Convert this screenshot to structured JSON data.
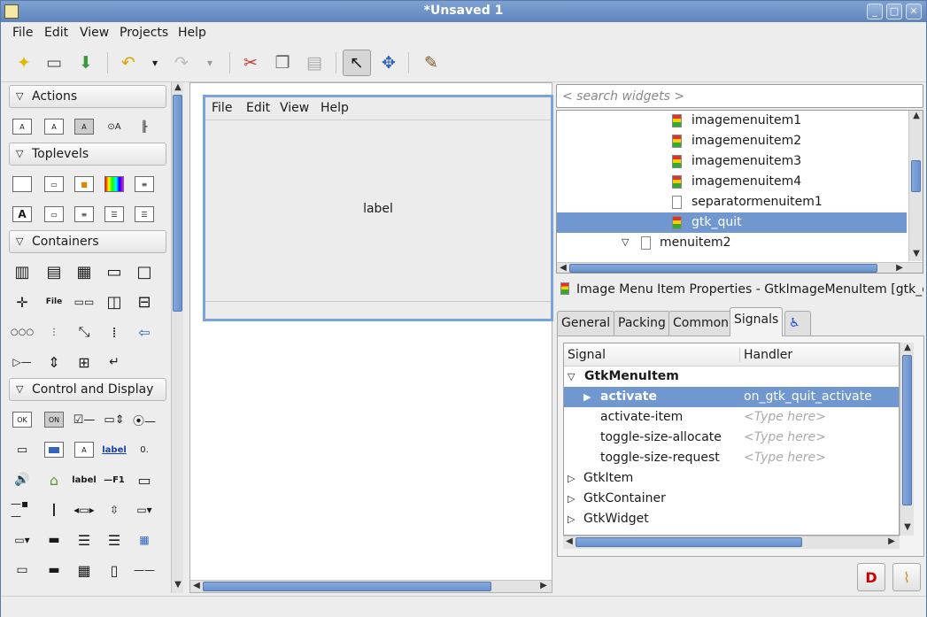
{
  "window": {
    "title": "*Unsaved 1"
  },
  "menubar": [
    "File",
    "Edit",
    "View",
    "Projects",
    "Help"
  ],
  "palette": {
    "groups": [
      "Actions",
      "Toplevels",
      "Containers",
      "Control and Display"
    ],
    "sample_texts": {
      "file": "File",
      "ok": "OK",
      "on": "ON",
      "label": "label",
      "label2": "label",
      "f1": "—F1",
      "a": "A"
    }
  },
  "design": {
    "menus": [
      "File",
      "Edit",
      "View",
      "Help"
    ],
    "label": "label"
  },
  "search": {
    "placeholder": "< search widgets >"
  },
  "tree": {
    "items": [
      "imagemenuitem1",
      "imagemenuitem2",
      "imagemenuitem3",
      "imagemenuitem4",
      "separatormenuitem1",
      "gtk_quit",
      "menuitem2"
    ],
    "selected": "gtk_quit"
  },
  "props": {
    "title": "Image Menu Item Properties - GtkImageMenuItem [gtk_q...",
    "tabs": [
      "General",
      "Packing",
      "Common",
      "Signals"
    ],
    "active_tab": "Signals"
  },
  "signals": {
    "headers": {
      "signal": "Signal",
      "handler": "Handler"
    },
    "group": "GtkMenuItem",
    "rows": [
      {
        "signal": "activate",
        "handler": "on_gtk_quit_activate"
      },
      {
        "signal": "activate-item",
        "handler": "<Type here>"
      },
      {
        "signal": "toggle-size-allocate",
        "handler": "<Type here>"
      },
      {
        "signal": "toggle-size-request",
        "handler": "<Type here>"
      }
    ],
    "other_groups": [
      "GtkItem",
      "GtkContainer",
      "GtkWidget"
    ]
  },
  "colors": {
    "selection": "#7097cf",
    "titlebar": "#6f92c6"
  }
}
